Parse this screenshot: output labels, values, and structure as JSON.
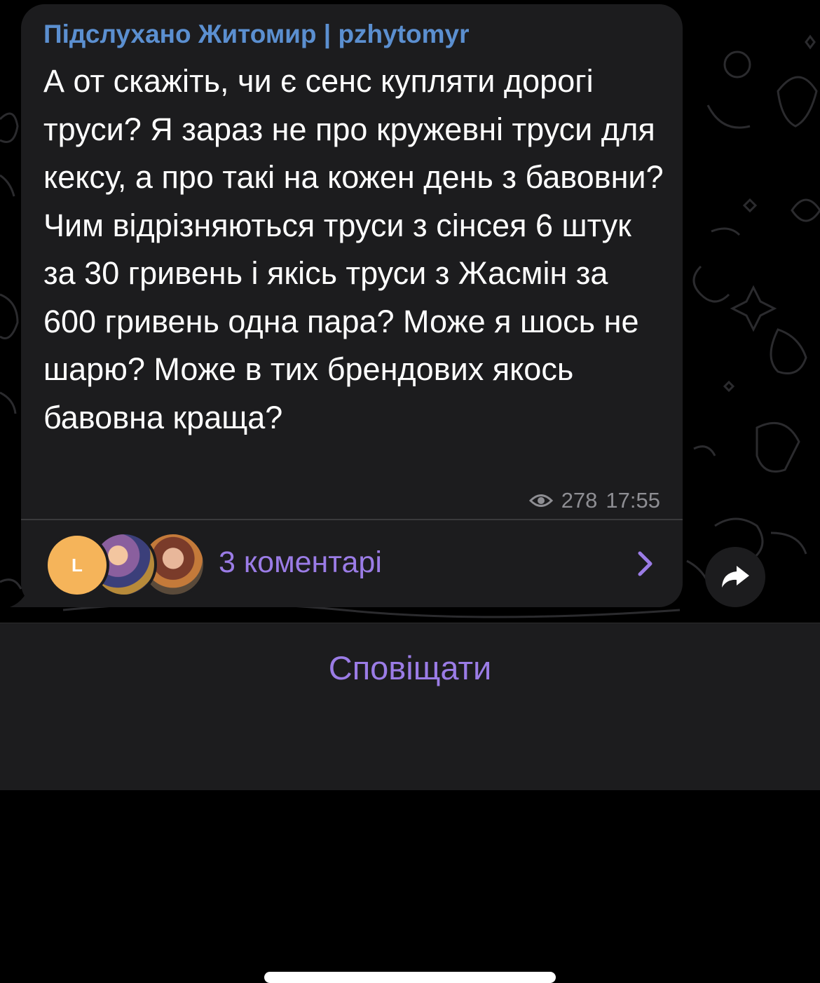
{
  "post": {
    "channel_name": "Підслухано Житомир | pzhytomyr",
    "text": "А от скажіть, чи є сенс купляти дорогі труси? Я зараз не про кружевні труси для кексу, а про такі на кожен день з бавовни? Чим відрізняються труси з сінсея 6 штук за 30 гривень і якісь труси з Жасмін за 600 гривень одна пара? Може я шось не шарю? Може в тих брендових якось бавовна краща?",
    "views": "278",
    "time": "17:55"
  },
  "comments": {
    "label": "3 коментарі",
    "avatars": [
      {
        "initial": "L",
        "color": "#f5b45a"
      },
      {
        "initial": "",
        "color": "#6a4f8e"
      },
      {
        "initial": "",
        "color": "#c47a3a"
      }
    ]
  },
  "bottom": {
    "notify_label": "Сповіщати"
  },
  "colors": {
    "accent": "#9b7ce6",
    "channel_name": "#5b8fd0",
    "bubble": "#1c1c1e",
    "meta": "#8e8e93"
  }
}
